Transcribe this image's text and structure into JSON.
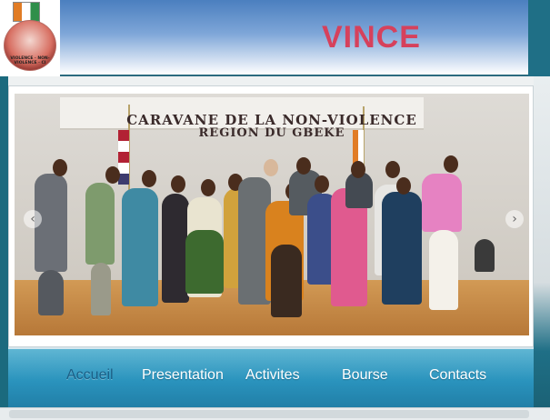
{
  "header": {
    "site_title": "VINCE",
    "logo_caption": "VIOLENCE · NON-VIOLENCE · CI"
  },
  "slider": {
    "banner_line1": "CARAVANE DE LA NON-VIOLENCE",
    "banner_line2": "REGION DU GBEKE",
    "prev_icon": "‹",
    "next_icon": "›"
  },
  "nav": {
    "items": [
      {
        "label": "Accueil",
        "active": true
      },
      {
        "label": "Presentation",
        "active": false
      },
      {
        "label": "Activites",
        "active": false
      },
      {
        "label": "Bourse",
        "active": false
      },
      {
        "label": "Contacts",
        "active": false
      }
    ]
  },
  "colors": {
    "title": "#d6415c",
    "nav_bg": "#2a93bd",
    "accent_teal": "#1f6f86"
  }
}
